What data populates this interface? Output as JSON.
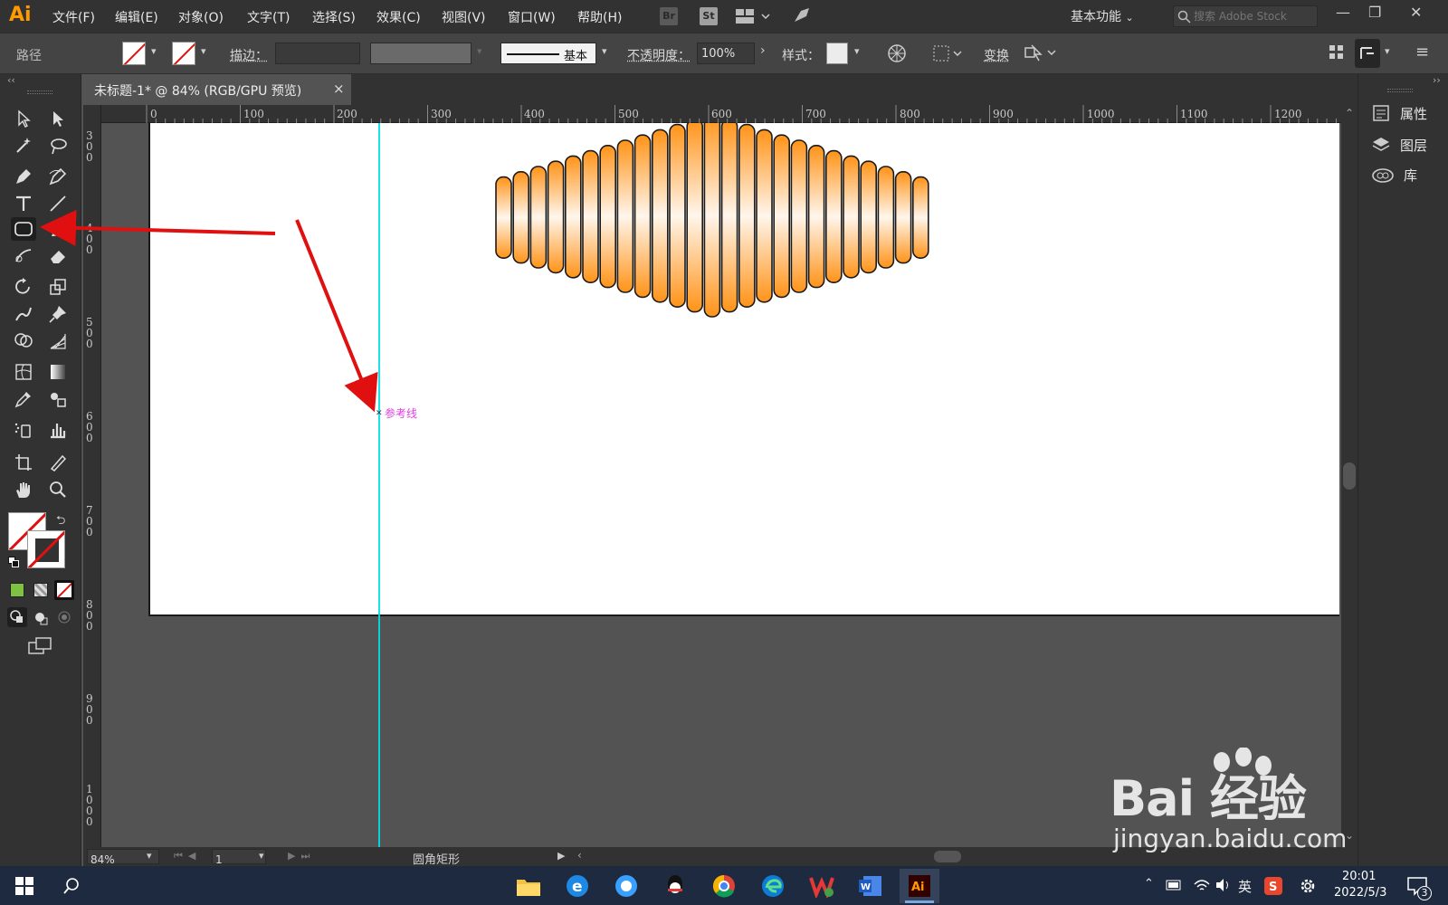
{
  "app": {
    "logo": "Ai",
    "window_title": "Adobe Illustrator"
  },
  "menu": [
    "文件(F)",
    "编辑(E)",
    "对象(O)",
    "文字(T)",
    "选择(S)",
    "效果(C)",
    "视图(V)",
    "窗口(W)",
    "帮助(H)"
  ],
  "bridge_buttons": {
    "br": "Br",
    "st": "St"
  },
  "workspace": {
    "label": "基本功能"
  },
  "stock_search": {
    "placeholder": "搜索 Adobe Stock"
  },
  "window_controls": {
    "minimize": "—",
    "restore": "❐",
    "close": "✕"
  },
  "control_bar": {
    "selection_type": "路径",
    "stroke_label": "描边：",
    "stroke_weight": "",
    "brush_label": "基本",
    "opacity_label": "不透明度：",
    "opacity_value": "100%",
    "style_label": "样式：",
    "transform_label": "变换"
  },
  "document": {
    "tab_title": "未标题-1* @ 84% (RGB/GPU 预览)",
    "close": "×"
  },
  "ruler": {
    "h_labels": [
      "0",
      "100",
      "200",
      "300",
      "400",
      "500",
      "600",
      "700",
      "800",
      "900",
      "1000",
      "1100",
      "1200"
    ],
    "v_labels": [
      "300",
      "400",
      "500",
      "600",
      "700",
      "800",
      "900",
      "1000"
    ]
  },
  "canvas": {
    "guide_label": "参考线",
    "artwork": {
      "fill_gradient": [
        "#ff9318",
        "#fff6ec",
        "#ff9318"
      ],
      "stroke": "#1a1a1a",
      "bar_count": 25
    }
  },
  "right_panel": {
    "items": [
      {
        "icon": "properties-icon",
        "label": "属性"
      },
      {
        "icon": "layers-icon",
        "label": "图层"
      },
      {
        "icon": "libraries-icon",
        "label": "库"
      }
    ]
  },
  "status_bar": {
    "zoom": "84%",
    "page": "1",
    "tool_status": "圆角矩形"
  },
  "taskbar": {
    "apps": [
      "explorer-icon",
      "ie-icon",
      "qq-browser-icon",
      "qq-icon",
      "chrome-icon",
      "edge-icon",
      "wps-icon",
      "word-icon",
      "illustrator-icon"
    ],
    "ime": "英",
    "time": "20:01",
    "date": "2022/5/3",
    "notification_count": "3"
  },
  "watermark": {
    "logo": "Bai 经验",
    "url": "jingyan.baidu.com"
  },
  "colors": {
    "accent": "#ff9a00",
    "guide": "#00dfe8",
    "arrow": "#e01010",
    "guide_label": "#e040e0"
  }
}
